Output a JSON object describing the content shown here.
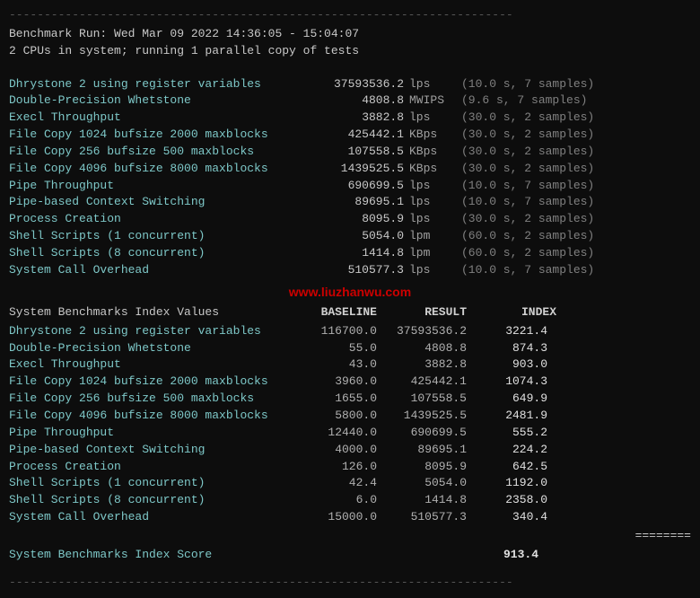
{
  "divider_top": "------------------------------------------------------------------------",
  "divider_bottom": "------------------------------------------------------------------------",
  "header": {
    "line1": "Benchmark Run: Wed Mar 09 2022 14:36:05 - 15:04:07",
    "line2": "2 CPUs in system; running 1 parallel copy of tests"
  },
  "benchmarks": [
    {
      "label": "Dhrystone 2 using register variables",
      "value": "37593536.2",
      "unit": "lps",
      "samples": "(10.0 s, 7 samples)"
    },
    {
      "label": "Double-Precision Whetstone",
      "value": "4808.8",
      "unit": "MWIPS",
      "samples": "(9.6 s, 7 samples)"
    },
    {
      "label": "Execl Throughput",
      "value": "3882.8",
      "unit": "lps",
      "samples": "(30.0 s, 2 samples)"
    },
    {
      "label": "File Copy 1024 bufsize 2000 maxblocks",
      "value": "425442.1",
      "unit": "KBps",
      "samples": "(30.0 s, 2 samples)"
    },
    {
      "label": "File Copy 256 bufsize 500 maxblocks",
      "value": "107558.5",
      "unit": "KBps",
      "samples": "(30.0 s, 2 samples)"
    },
    {
      "label": "File Copy 4096 bufsize 8000 maxblocks",
      "value": "1439525.5",
      "unit": "KBps",
      "samples": "(30.0 s, 2 samples)"
    },
    {
      "label": "Pipe Throughput",
      "value": "690699.5",
      "unit": "lps",
      "samples": "(10.0 s, 7 samples)"
    },
    {
      "label": "Pipe-based Context Switching",
      "value": "89695.1",
      "unit": "lps",
      "samples": "(10.0 s, 7 samples)"
    },
    {
      "label": "Process Creation",
      "value": "8095.9",
      "unit": "lps",
      "samples": "(30.0 s, 2 samples)"
    },
    {
      "label": "Shell Scripts (1 concurrent)",
      "value": "5054.0",
      "unit": "lpm",
      "samples": "(60.0 s, 2 samples)"
    },
    {
      "label": "Shell Scripts (8 concurrent)",
      "value": "1414.8",
      "unit": "lpm",
      "samples": "(60.0 s, 2 samples)"
    },
    {
      "label": "System Call Overhead",
      "value": "510577.3",
      "unit": "lps",
      "samples": "(10.0 s, 7 samples)"
    }
  ],
  "watermark": "www.liuzhanwu.com",
  "index_table": {
    "header": {
      "label": "System Benchmarks Index Values",
      "baseline": "BASELINE",
      "result": "RESULT",
      "index": "INDEX"
    },
    "rows": [
      {
        "label": "Dhrystone 2 using register variables",
        "baseline": "116700.0",
        "result": "37593536.2",
        "index": "3221.4"
      },
      {
        "label": "Double-Precision Whetstone",
        "baseline": "55.0",
        "result": "4808.8",
        "index": "874.3"
      },
      {
        "label": "Execl Throughput",
        "baseline": "43.0",
        "result": "3882.8",
        "index": "903.0"
      },
      {
        "label": "File Copy 1024 bufsize 2000 maxblocks",
        "baseline": "3960.0",
        "result": "425442.1",
        "index": "1074.3"
      },
      {
        "label": "File Copy 256 bufsize 500 maxblocks",
        "baseline": "1655.0",
        "result": "107558.5",
        "index": "649.9"
      },
      {
        "label": "File Copy 4096 bufsize 8000 maxblocks",
        "baseline": "5800.0",
        "result": "1439525.5",
        "index": "2481.9"
      },
      {
        "label": "Pipe Throughput",
        "baseline": "12440.0",
        "result": "690699.5",
        "index": "555.2"
      },
      {
        "label": "Pipe-based Context Switching",
        "baseline": "4000.0",
        "result": "89695.1",
        "index": "224.2"
      },
      {
        "label": "Process Creation",
        "baseline": "126.0",
        "result": "8095.9",
        "index": "642.5"
      },
      {
        "label": "Shell Scripts (1 concurrent)",
        "baseline": "42.4",
        "result": "5054.0",
        "index": "1192.0"
      },
      {
        "label": "Shell Scripts (8 concurrent)",
        "baseline": "6.0",
        "result": "1414.8",
        "index": "2358.0"
      },
      {
        "label": "System Call Overhead",
        "baseline": "15000.0",
        "result": "510577.3",
        "index": "340.4"
      }
    ],
    "equals": "========",
    "score_label": "System Benchmarks Index Score",
    "score_value": "913.4"
  }
}
